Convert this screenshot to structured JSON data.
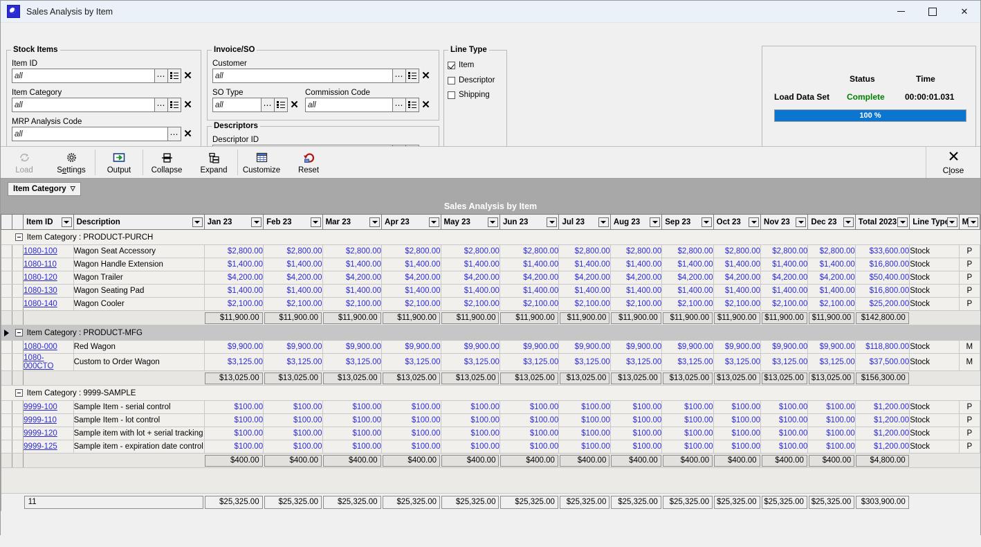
{
  "window": {
    "title": "Sales Analysis by Item",
    "app_icon": "app-icon",
    "minimize": "–",
    "maximize": "□",
    "close": "✕"
  },
  "criteria": {
    "stock_items": {
      "legend": "Stock Items",
      "fields": [
        {
          "label": "Item ID",
          "value": "all",
          "buttons": [
            "ellipsis-icon",
            "list-icon",
            "clear-icon"
          ]
        },
        {
          "label": "Item Category",
          "value": "all",
          "buttons": [
            "ellipsis-icon",
            "list-icon",
            "clear-icon"
          ]
        },
        {
          "label": "MRP Analysis Code",
          "value": "all",
          "buttons": [
            "ellipsis-icon",
            "clear-icon"
          ]
        }
      ]
    },
    "invoice_so": {
      "legend": "Invoice/SO",
      "fields": [
        {
          "label": "Customer",
          "value": "all"
        },
        {
          "label": "SO Type",
          "value": "all"
        },
        {
          "label": "Commission Code",
          "value": "all"
        }
      ]
    },
    "descriptors": {
      "legend": "Descriptors",
      "fields": [
        {
          "label": "Descriptor ID",
          "value": ""
        }
      ]
    },
    "line_type": {
      "legend": "Line Type",
      "options": [
        {
          "label": "Item",
          "checked": true
        },
        {
          "label": "Descriptor",
          "checked": false
        },
        {
          "label": "Shipping",
          "checked": false
        }
      ]
    }
  },
  "status_panel": {
    "status_header": "Status",
    "time_header": "Time",
    "task_label": "Load Data Set",
    "status_value": "Complete",
    "status_color": "#008000",
    "time_value": "00:00:01.031",
    "progress_label": "100 %",
    "progress_percent": 100,
    "progress_color": "#0a76d2"
  },
  "toolbar": {
    "buttons": [
      {
        "name": "load",
        "label": "Load",
        "icon": "refresh-icon",
        "disabled": true
      },
      {
        "name": "settings",
        "label": "Settings",
        "icon": "gear-icon",
        "disabled": false
      },
      {
        "name": "output",
        "label": "Output",
        "icon": "export-icon",
        "disabled": false
      },
      {
        "name": "collapse",
        "label": "Collapse",
        "icon": "collapse-icon",
        "disabled": false
      },
      {
        "name": "expand",
        "label": "Expand",
        "icon": "expand-icon",
        "disabled": false
      },
      {
        "name": "customize",
        "label": "Customize",
        "icon": "grid-icon",
        "disabled": false
      },
      {
        "name": "reset",
        "label": "Reset",
        "icon": "undo-icon",
        "disabled": false
      }
    ],
    "close_label": "Close",
    "close_icon": "close-x-icon"
  },
  "grid": {
    "tab_label": "Item Category",
    "tab_glyph": "▽",
    "title": "Sales Analysis by Item",
    "columns": [
      "Item ID",
      "Description",
      "Jan 23",
      "Feb 23",
      "Mar 23",
      "Apr 23",
      "May 23",
      "Jun 23",
      "Jul 23",
      "Aug 23",
      "Sep 23",
      "Oct 23",
      "Nov 23",
      "Dec 23",
      "Total 2023",
      "Line Type",
      "M/P"
    ],
    "group_label_prefix": "Item Category :",
    "groups": [
      {
        "name": "PRODUCT-PURCH",
        "selected": false,
        "rows": [
          {
            "id": "1080-100",
            "desc": "Wagon Seat Accessory",
            "months": [
              "$2,800.00",
              "$2,800.00",
              "$2,800.00",
              "$2,800.00",
              "$2,800.00",
              "$2,800.00",
              "$2,800.00",
              "$2,800.00",
              "$2,800.00",
              "$2,800.00",
              "$2,800.00",
              "$2,800.00"
            ],
            "total": "$33,600.00",
            "line_type": "Stock",
            "mp": "P"
          },
          {
            "id": "1080-110",
            "desc": "Wagon Handle Extension",
            "months": [
              "$1,400.00",
              "$1,400.00",
              "$1,400.00",
              "$1,400.00",
              "$1,400.00",
              "$1,400.00",
              "$1,400.00",
              "$1,400.00",
              "$1,400.00",
              "$1,400.00",
              "$1,400.00",
              "$1,400.00"
            ],
            "total": "$16,800.00",
            "line_type": "Stock",
            "mp": "P"
          },
          {
            "id": "1080-120",
            "desc": "Wagon Trailer",
            "months": [
              "$4,200.00",
              "$4,200.00",
              "$4,200.00",
              "$4,200.00",
              "$4,200.00",
              "$4,200.00",
              "$4,200.00",
              "$4,200.00",
              "$4,200.00",
              "$4,200.00",
              "$4,200.00",
              "$4,200.00"
            ],
            "total": "$50,400.00",
            "line_type": "Stock",
            "mp": "P"
          },
          {
            "id": "1080-130",
            "desc": "Wagon Seating Pad",
            "months": [
              "$1,400.00",
              "$1,400.00",
              "$1,400.00",
              "$1,400.00",
              "$1,400.00",
              "$1,400.00",
              "$1,400.00",
              "$1,400.00",
              "$1,400.00",
              "$1,400.00",
              "$1,400.00",
              "$1,400.00"
            ],
            "total": "$16,800.00",
            "line_type": "Stock",
            "mp": "P"
          },
          {
            "id": "1080-140",
            "desc": "Wagon Cooler",
            "months": [
              "$2,100.00",
              "$2,100.00",
              "$2,100.00",
              "$2,100.00",
              "$2,100.00",
              "$2,100.00",
              "$2,100.00",
              "$2,100.00",
              "$2,100.00",
              "$2,100.00",
              "$2,100.00",
              "$2,100.00"
            ],
            "total": "$25,200.00",
            "line_type": "Stock",
            "mp": "P"
          }
        ],
        "subtotal": {
          "months": [
            "$11,900.00",
            "$11,900.00",
            "$11,900.00",
            "$11,900.00",
            "$11,900.00",
            "$11,900.00",
            "$11,900.00",
            "$11,900.00",
            "$11,900.00",
            "$11,900.00",
            "$11,900.00",
            "$11,900.00"
          ],
          "total": "$142,800.00"
        }
      },
      {
        "name": "PRODUCT-MFG",
        "selected": true,
        "rows": [
          {
            "id": "1080-000",
            "desc": "Red Wagon",
            "months": [
              "$9,900.00",
              "$9,900.00",
              "$9,900.00",
              "$9,900.00",
              "$9,900.00",
              "$9,900.00",
              "$9,900.00",
              "$9,900.00",
              "$9,900.00",
              "$9,900.00",
              "$9,900.00",
              "$9,900.00"
            ],
            "total": "$118,800.00",
            "line_type": "Stock",
            "mp": "M"
          },
          {
            "id": "1080-000CTO",
            "desc": "Custom to Order Wagon",
            "months": [
              "$3,125.00",
              "$3,125.00",
              "$3,125.00",
              "$3,125.00",
              "$3,125.00",
              "$3,125.00",
              "$3,125.00",
              "$3,125.00",
              "$3,125.00",
              "$3,125.00",
              "$3,125.00",
              "$3,125.00"
            ],
            "total": "$37,500.00",
            "line_type": "Stock",
            "mp": "M"
          }
        ],
        "subtotal": {
          "months": [
            "$13,025.00",
            "$13,025.00",
            "$13,025.00",
            "$13,025.00",
            "$13,025.00",
            "$13,025.00",
            "$13,025.00",
            "$13,025.00",
            "$13,025.00",
            "$13,025.00",
            "$13,025.00",
            "$13,025.00"
          ],
          "total": "$156,300.00"
        }
      },
      {
        "name": "9999-SAMPLE",
        "selected": false,
        "rows": [
          {
            "id": "9999-100",
            "desc": "Sample Item - serial control",
            "months": [
              "$100.00",
              "$100.00",
              "$100.00",
              "$100.00",
              "$100.00",
              "$100.00",
              "$100.00",
              "$100.00",
              "$100.00",
              "$100.00",
              "$100.00",
              "$100.00"
            ],
            "total": "$1,200.00",
            "line_type": "Stock",
            "mp": "P"
          },
          {
            "id": "9999-110",
            "desc": "Sample Item - lot control",
            "months": [
              "$100.00",
              "$100.00",
              "$100.00",
              "$100.00",
              "$100.00",
              "$100.00",
              "$100.00",
              "$100.00",
              "$100.00",
              "$100.00",
              "$100.00",
              "$100.00"
            ],
            "total": "$1,200.00",
            "line_type": "Stock",
            "mp": "P"
          },
          {
            "id": "9999-120",
            "desc": "Sample item with lot + serial tracking",
            "months": [
              "$100.00",
              "$100.00",
              "$100.00",
              "$100.00",
              "$100.00",
              "$100.00",
              "$100.00",
              "$100.00",
              "$100.00",
              "$100.00",
              "$100.00",
              "$100.00"
            ],
            "total": "$1,200.00",
            "line_type": "Stock",
            "mp": "P"
          },
          {
            "id": "9999-125",
            "desc": "Sample item - expiration date control",
            "months": [
              "$100.00",
              "$100.00",
              "$100.00",
              "$100.00",
              "$100.00",
              "$100.00",
              "$100.00",
              "$100.00",
              "$100.00",
              "$100.00",
              "$100.00",
              "$100.00"
            ],
            "total": "$1,200.00",
            "line_type": "Stock",
            "mp": "P"
          }
        ],
        "subtotal": {
          "months": [
            "$400.00",
            "$400.00",
            "$400.00",
            "$400.00",
            "$400.00",
            "$400.00",
            "$400.00",
            "$400.00",
            "$400.00",
            "$400.00",
            "$400.00",
            "$400.00"
          ],
          "total": "$4,800.00"
        }
      }
    ],
    "footer": {
      "count": "11",
      "months": [
        "$25,325.00",
        "$25,325.00",
        "$25,325.00",
        "$25,325.00",
        "$25,325.00",
        "$25,325.00",
        "$25,325.00",
        "$25,325.00",
        "$25,325.00",
        "$25,325.00",
        "$25,325.00",
        "$25,325.00"
      ],
      "total": "$303,900.00"
    }
  }
}
